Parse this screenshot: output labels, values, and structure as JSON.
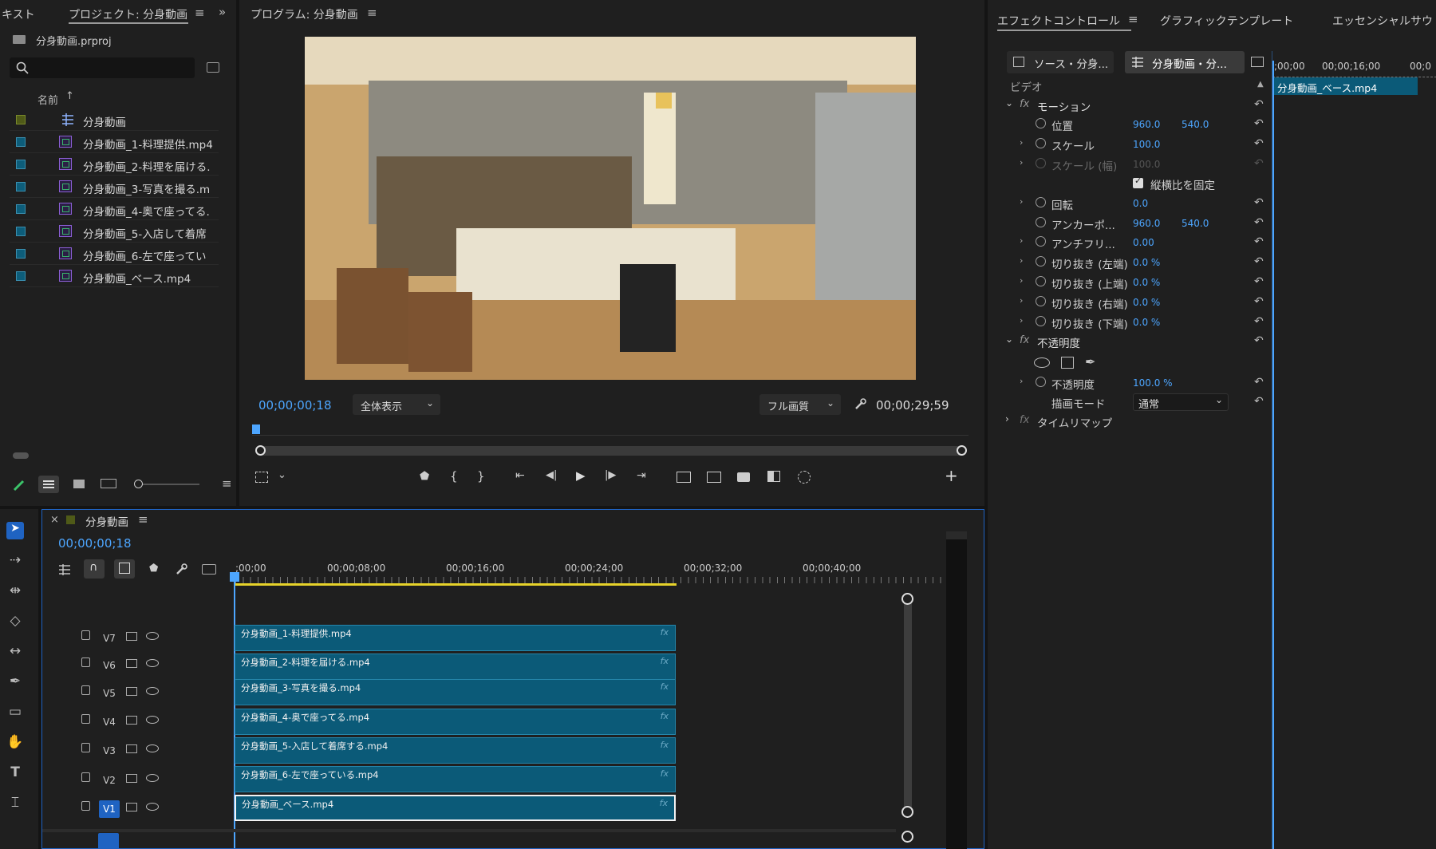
{
  "project_panel": {
    "tab_prev": "キスト",
    "tab_active": "プロジェクト: 分身動画",
    "project_file": "分身動画.prproj",
    "search_placeholder": "",
    "column_name": "名前",
    "items": [
      {
        "name": "分身動画",
        "type": "sequence",
        "color": "#4f5a18"
      },
      {
        "name": "分身動画_1-料理提供.mp4",
        "type": "clip"
      },
      {
        "name": "分身動画_2-料理を届ける.",
        "type": "clip"
      },
      {
        "name": "分身動画_3-写真を撮る.m",
        "type": "clip"
      },
      {
        "name": "分身動画_4-奥で座ってる.",
        "type": "clip"
      },
      {
        "name": "分身動画_5-入店して着席",
        "type": "clip"
      },
      {
        "name": "分身動画_6-左で座ってい",
        "type": "clip"
      },
      {
        "name": "分身動画_ベース.mp4",
        "type": "clip"
      }
    ]
  },
  "program_monitor": {
    "title": "プログラム: 分身動画",
    "current_time": "00;00;00;18",
    "zoom": "全体表示",
    "quality": "フル画質",
    "duration": "00;00;29;59"
  },
  "effect_controls": {
    "tab_active": "エフェクトコントロール",
    "tab_2": "グラフィックテンプレート",
    "tab_3": "エッセンシャルサウ",
    "source_tab": "ソース・分身...",
    "sequence_tab": "分身動画・分...",
    "section_video": "ビデオ",
    "mini_timeline": {
      "tick1": ";00;00",
      "tick2": "00;00;16;00",
      "tick3": "00;0",
      "clip_name": "分身動画_ベース.mp4"
    },
    "motion": {
      "header": "モーション",
      "position_label": "位置",
      "position_x": "960.0",
      "position_y": "540.0",
      "scale_label": "スケール",
      "scale_value": "100.0",
      "scale_w_label": "スケール (幅)",
      "scale_w_value": "100.0",
      "uniform_label": "縦横比を固定",
      "rotation_label": "回転",
      "rotation_value": "0.0",
      "anchor_label": "アンカーポ...",
      "anchor_x": "960.0",
      "anchor_y": "540.0",
      "antiflicker_label": "アンチフリ...",
      "antiflicker_value": "0.00",
      "crop_left_label": "切り抜き (左端)",
      "crop_left_value": "0.0 %",
      "crop_top_label": "切り抜き (上端)",
      "crop_top_value": "0.0 %",
      "crop_right_label": "切り抜き (右端)",
      "crop_right_value": "0.0 %",
      "crop_bottom_label": "切り抜き (下端)",
      "crop_bottom_value": "0.0 %"
    },
    "opacity": {
      "header": "不透明度",
      "opacity_label": "不透明度",
      "opacity_value": "100.0 %",
      "blend_label": "描画モード",
      "blend_value": "通常"
    },
    "time_remap": "タイムリマップ"
  },
  "timeline": {
    "sequence_name": "分身動画",
    "current_time": "00;00;00;18",
    "ruler": [
      ";00;00",
      "00;00;08;00",
      "00;00;16;00",
      "00;00;24;00",
      "00;00;32;00",
      "00;00;40;00"
    ],
    "tracks": [
      {
        "name": "V7",
        "clip": "分身動画_1-料理提供.mp4"
      },
      {
        "name": "V6",
        "clip": "分身動画_2-料理を届ける.mp4"
      },
      {
        "name": "V5",
        "clip": "分身動画_3-写真を撮る.mp4"
      },
      {
        "name": "V4",
        "clip": "分身動画_4-奥で座ってる.mp4"
      },
      {
        "name": "V3",
        "clip": "分身動画_5-入店して着席する.mp4"
      },
      {
        "name": "V2",
        "clip": "分身動画_6-左で座っている.mp4"
      },
      {
        "name": "V1",
        "clip": "分身動画_ベース.mp4"
      }
    ],
    "fx_badge": "fx"
  },
  "colors": {
    "accent_blue": "#4da6ff",
    "clip_fill": "#0b5a78",
    "work_area": "#e6d22a"
  }
}
